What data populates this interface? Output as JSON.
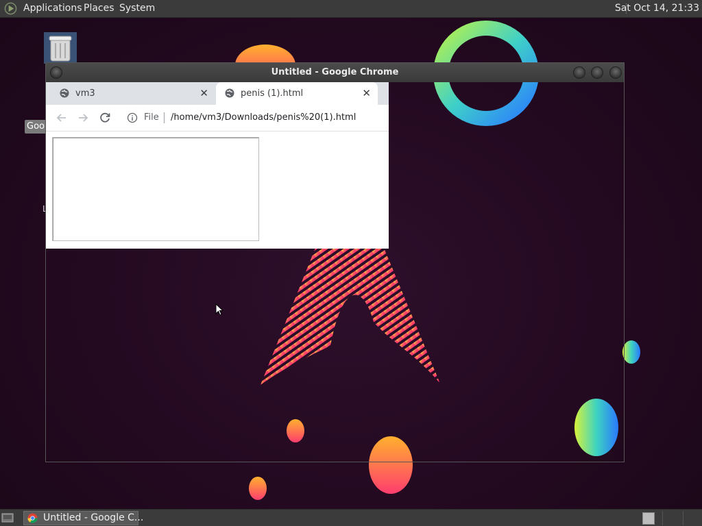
{
  "top_panel": {
    "menus": [
      "Applications",
      "Places",
      "System"
    ],
    "clock": "Sat Oct 14, 21:33"
  },
  "desktop": {
    "icons": [
      {
        "name": "trash",
        "label": ""
      },
      {
        "name": "google-chrome",
        "label": "Goo"
      },
      {
        "name": "file",
        "label": "L"
      }
    ]
  },
  "window": {
    "title": "Untitled - Google Chrome",
    "tabs": [
      {
        "title": "vm3",
        "active": false
      },
      {
        "title": "penis (1).html",
        "active": true
      }
    ],
    "omnibox": {
      "scheme_label": "File",
      "url": "/home/vm3/Downloads/penis%20(1).html"
    }
  },
  "taskbar": {
    "items": [
      {
        "label": "Untitled - Google C...",
        "icon": "chrome-icon"
      }
    ]
  },
  "colors": {
    "panel": "#3b3b3b",
    "wallpaper": "#250d23",
    "tab_strip": "#dee1e6"
  }
}
